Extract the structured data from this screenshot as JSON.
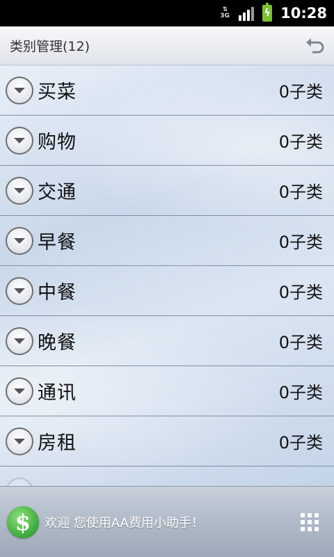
{
  "status_bar": {
    "network": "3G",
    "time": "10:28",
    "icons": [
      "3g-icon",
      "signal-icon",
      "battery-charging-icon"
    ]
  },
  "header": {
    "title": "类别管理(12)",
    "back_icon": "back-icon"
  },
  "categories": [
    {
      "name": "买菜",
      "sub_count": "0子类"
    },
    {
      "name": "购物",
      "sub_count": "0子类"
    },
    {
      "name": "交通",
      "sub_count": "0子类"
    },
    {
      "name": "早餐",
      "sub_count": "0子类"
    },
    {
      "name": "中餐",
      "sub_count": "0子类"
    },
    {
      "name": "晚餐",
      "sub_count": "0子类"
    },
    {
      "name": "通讯",
      "sub_count": "0子类"
    },
    {
      "name": "房租",
      "sub_count": "0子类"
    }
  ],
  "footer": {
    "app_icon": "dollar-icon",
    "welcome": "欢迎 您使用AA费用小助手！",
    "menu_icon": "grid-menu-icon"
  },
  "colors": {
    "accent_green": "#3aa83a",
    "row_divider": "#7f8fa4",
    "battery": "#7cc233"
  }
}
